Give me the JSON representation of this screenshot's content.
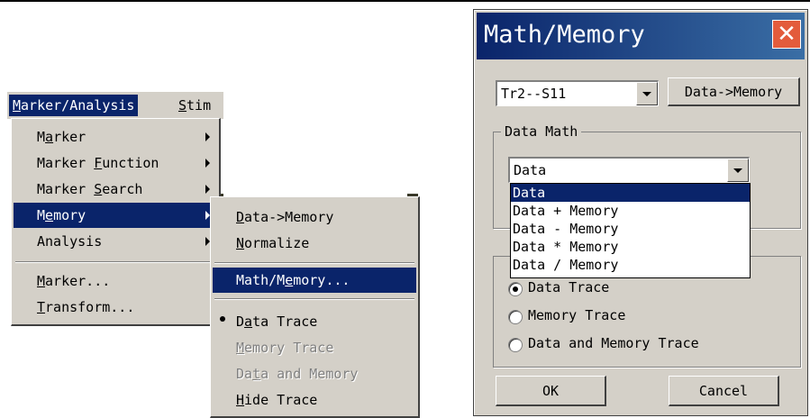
{
  "menu_screenshot": {
    "menubar": [
      {
        "label": "Marker/Analysis",
        "mnemonic": "M",
        "active": true
      },
      {
        "label": "Stim",
        "mnemonic": "S",
        "active": false
      }
    ],
    "menu": [
      {
        "label": "Marker",
        "mnemonic": "a",
        "submenu": true
      },
      {
        "label": "Marker Function",
        "mnemonic": "F",
        "submenu": true
      },
      {
        "label": "Marker Search",
        "mnemonic": "S",
        "submenu": true
      },
      {
        "label": "Memory",
        "mnemonic": "e",
        "submenu": true,
        "highlighted": true
      },
      {
        "label": "Analysis",
        "mnemonic": "",
        "submenu": true
      },
      {
        "label": "Marker...",
        "mnemonic": "M",
        "submenu": false
      },
      {
        "label": "Transform...",
        "mnemonic": "T",
        "submenu": false
      }
    ],
    "submenu": [
      {
        "label": "Data->Memory",
        "mnemonic": "D"
      },
      {
        "label": "Normalize",
        "mnemonic": "N"
      },
      {
        "label": "Math/Memory...",
        "mnemonic": "e",
        "highlighted": true
      },
      {
        "label": "Data Trace",
        "mnemonic": "a",
        "checked": true
      },
      {
        "label": "Memory Trace",
        "mnemonic": "M",
        "disabled": true
      },
      {
        "label": "Data and Memory",
        "mnemonic": "t",
        "disabled": true
      },
      {
        "label": "Hide Trace",
        "mnemonic": "H"
      }
    ]
  },
  "dialog": {
    "title": "Math/Memory",
    "trace_select": "Tr2--S11",
    "data_to_memory_button": "Data->Memory",
    "data_math_label": "Data Math",
    "data_math_value": "Data",
    "data_math_options": [
      "Data",
      "Data + Memory",
      "Data - Memory",
      "Data * Memory",
      "Data / Memory"
    ],
    "display_options": [
      {
        "label": "Data Trace",
        "selected": true
      },
      {
        "label": "Memory Trace",
        "selected": false
      },
      {
        "label": "Data and Memory Trace",
        "selected": false
      }
    ],
    "ok_label": "OK",
    "cancel_label": "Cancel"
  },
  "colors": {
    "highlight": "#0a246a",
    "face": "#d4d0c8",
    "close_button": "#e35c3c"
  }
}
